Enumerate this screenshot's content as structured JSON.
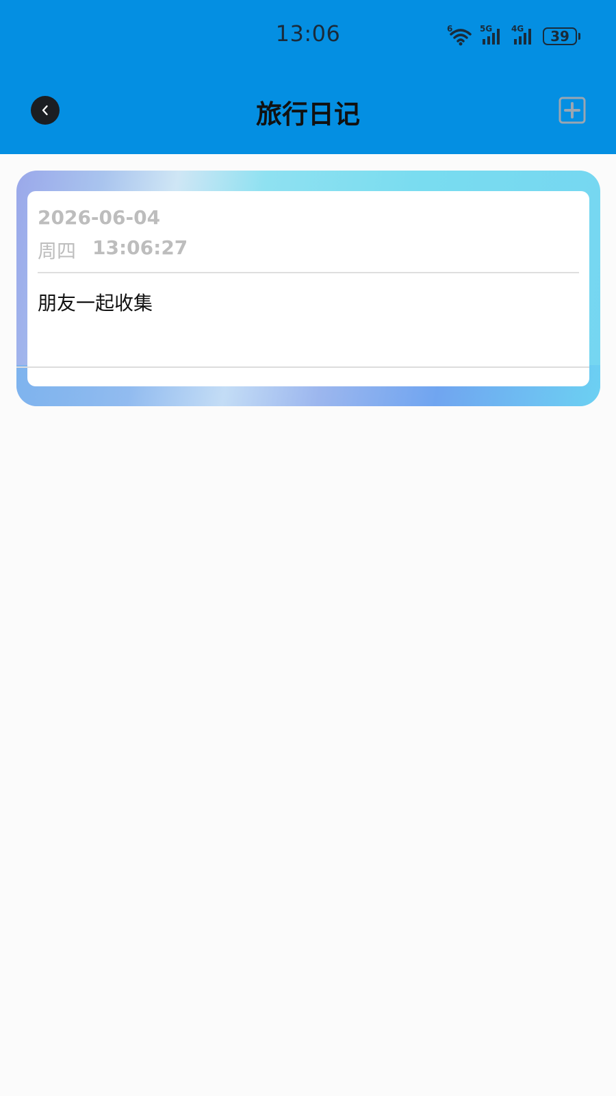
{
  "status_bar": {
    "time": "13:06",
    "wifi_label": "6",
    "signal1_label": "5G",
    "signal2_label": "4G",
    "battery_level": "39"
  },
  "nav": {
    "title": "旅行日记"
  },
  "entries": [
    {
      "date": "2026-06-04",
      "weekday": "周四",
      "time": "13:06:27",
      "content": "朋友一起收集"
    }
  ],
  "colors": {
    "header_bg": "#048fe2",
    "page_bg": "#fbfbfb",
    "card_gradient_start": "#9aa8ea",
    "card_gradient_end": "#75d6f1"
  },
  "icons": {
    "back": "chevron-left-icon",
    "add": "plus-square-icon",
    "wifi": "wifi-icon",
    "signal": "signal-icon",
    "battery": "battery-icon"
  }
}
